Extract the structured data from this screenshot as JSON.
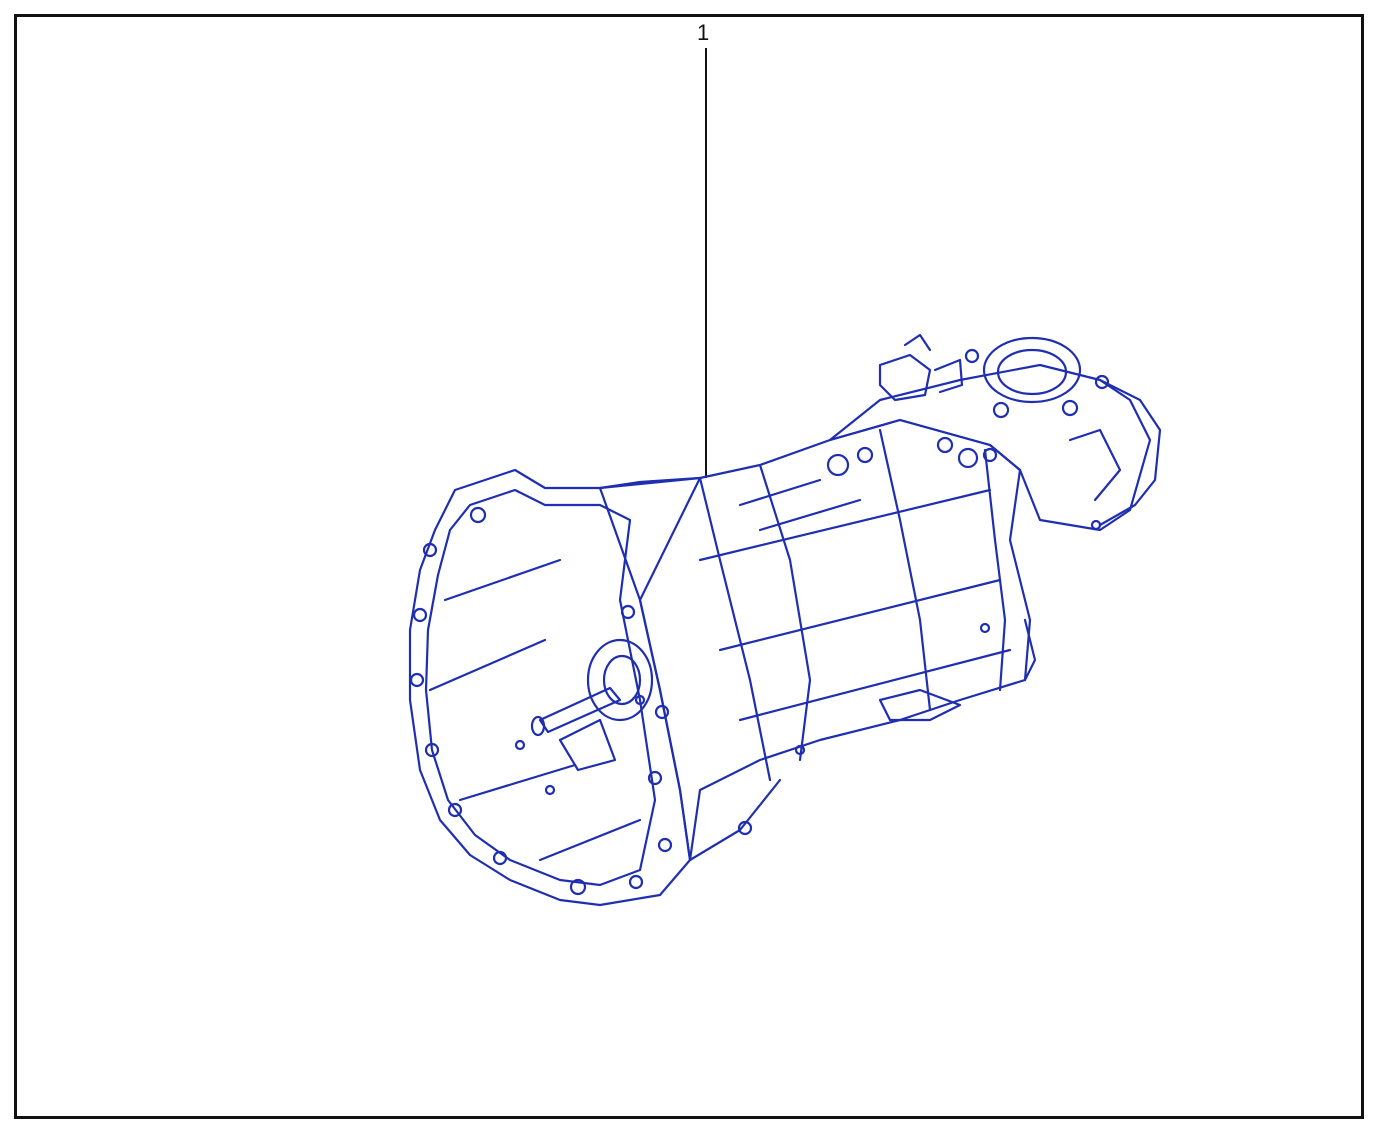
{
  "diagram": {
    "callouts": [
      {
        "label": "1"
      }
    ],
    "part_name": "transmission-assembly",
    "colors": {
      "line_art": "#1f2fb0",
      "frame": "#111111",
      "leader": "#111111",
      "background": "#ffffff"
    }
  }
}
